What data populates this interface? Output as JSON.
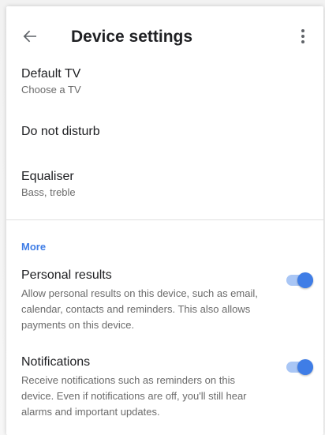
{
  "header": {
    "title": "Device settings",
    "back_icon": "arrow-back-icon",
    "menu_icon": "more-vert-icon"
  },
  "settings": {
    "default_tv": {
      "label": "Default TV",
      "sub": "Choose a TV"
    },
    "dnd": {
      "label": "Do not disturb"
    },
    "equaliser": {
      "label": "Equaliser",
      "sub": "Bass, treble"
    }
  },
  "more": {
    "heading": "More",
    "personal": {
      "label": "Personal results",
      "desc": "Allow personal results on this device, such as email, calendar, contacts and reminders. This also allows payments on this device.",
      "on": true
    },
    "notifications": {
      "label": "Notifications",
      "desc": "Receive notifications such as reminders on this device. Even if notifications are off, you'll still hear alarms and important updates.",
      "on": true
    }
  },
  "colors": {
    "accent": "#3f7de6",
    "track": "#a9c6f5"
  }
}
